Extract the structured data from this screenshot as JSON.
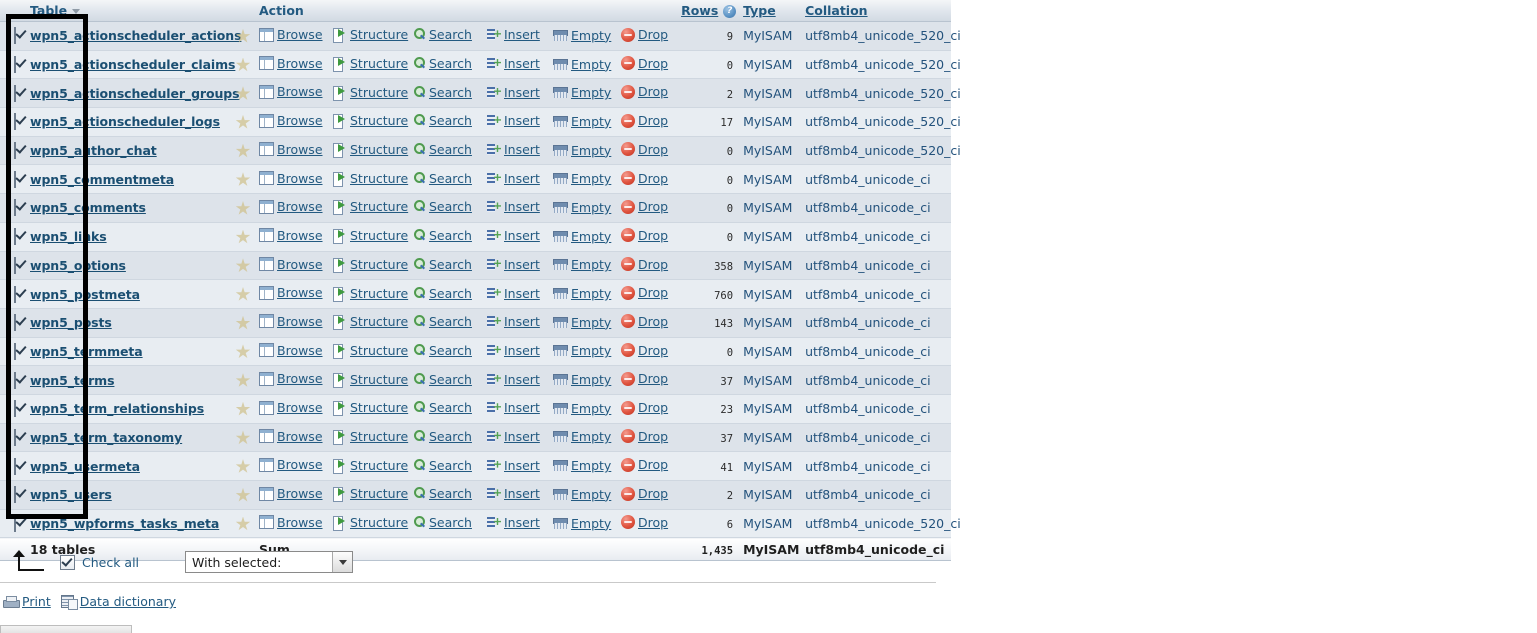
{
  "table": {
    "columns": {
      "check": "",
      "name": "Table",
      "action": "Action",
      "rows": "Rows",
      "type": "Type",
      "collation": "Collation"
    },
    "actions": {
      "browse": "Browse",
      "structure": "Structure",
      "search": "Search",
      "insert": "Insert",
      "empty": "Empty",
      "drop": "Drop"
    },
    "rows": [
      {
        "name": "wpn5_actionscheduler_actions",
        "rows": "9",
        "type": "MyISAM",
        "collation": "utf8mb4_unicode_520_ci"
      },
      {
        "name": "wpn5_actionscheduler_claims",
        "rows": "0",
        "type": "MyISAM",
        "collation": "utf8mb4_unicode_520_ci"
      },
      {
        "name": "wpn5_actionscheduler_groups",
        "rows": "2",
        "type": "MyISAM",
        "collation": "utf8mb4_unicode_520_ci"
      },
      {
        "name": "wpn5_actionscheduler_logs",
        "rows": "17",
        "type": "MyISAM",
        "collation": "utf8mb4_unicode_520_ci"
      },
      {
        "name": "wpn5_author_chat",
        "rows": "0",
        "type": "MyISAM",
        "collation": "utf8mb4_unicode_520_ci"
      },
      {
        "name": "wpn5_commentmeta",
        "rows": "0",
        "type": "MyISAM",
        "collation": "utf8mb4_unicode_ci"
      },
      {
        "name": "wpn5_comments",
        "rows": "0",
        "type": "MyISAM",
        "collation": "utf8mb4_unicode_ci"
      },
      {
        "name": "wpn5_links",
        "rows": "0",
        "type": "MyISAM",
        "collation": "utf8mb4_unicode_ci"
      },
      {
        "name": "wpn5_options",
        "rows": "358",
        "type": "MyISAM",
        "collation": "utf8mb4_unicode_ci"
      },
      {
        "name": "wpn5_postmeta",
        "rows": "760",
        "type": "MyISAM",
        "collation": "utf8mb4_unicode_ci"
      },
      {
        "name": "wpn5_posts",
        "rows": "143",
        "type": "MyISAM",
        "collation": "utf8mb4_unicode_ci"
      },
      {
        "name": "wpn5_termmeta",
        "rows": "0",
        "type": "MyISAM",
        "collation": "utf8mb4_unicode_ci"
      },
      {
        "name": "wpn5_terms",
        "rows": "37",
        "type": "MyISAM",
        "collation": "utf8mb4_unicode_ci"
      },
      {
        "name": "wpn5_term_relationships",
        "rows": "23",
        "type": "MyISAM",
        "collation": "utf8mb4_unicode_ci"
      },
      {
        "name": "wpn5_term_taxonomy",
        "rows": "37",
        "type": "MyISAM",
        "collation": "utf8mb4_unicode_ci"
      },
      {
        "name": "wpn5_usermeta",
        "rows": "41",
        "type": "MyISAM",
        "collation": "utf8mb4_unicode_ci"
      },
      {
        "name": "wpn5_users",
        "rows": "2",
        "type": "MyISAM",
        "collation": "utf8mb4_unicode_ci"
      },
      {
        "name": "wpn5_wpforms_tasks_meta",
        "rows": "6",
        "type": "MyISAM",
        "collation": "utf8mb4_unicode_520_ci"
      }
    ],
    "summary": {
      "count_label": "18 tables",
      "sum_label": "Sum",
      "rows_total": "1,435",
      "type": "MyISAM",
      "collation": "utf8mb4_unicode_ci"
    }
  },
  "controls": {
    "check_all_label": "Check all",
    "check_all_checked": true,
    "with_selected_label": "With selected:"
  },
  "bottom": {
    "print_label": "Print",
    "data_dictionary_label": "Data dictionary"
  },
  "colors": {
    "link": "#235a81",
    "table_name": "#1b4f72",
    "row_odd": "#dde3ea",
    "row_even": "#e8edf2",
    "header_text": "#235a81",
    "annotation": "#000000"
  }
}
